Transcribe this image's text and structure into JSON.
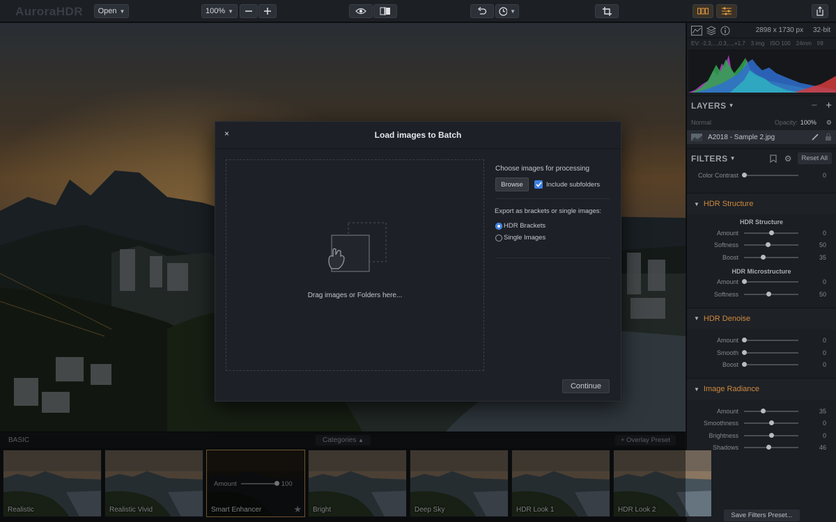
{
  "toolbar": {
    "logo": "AuroraHDR",
    "open_label": "Open",
    "zoom_value": "100%"
  },
  "panel": {
    "image_size": "2898 x 1730 px",
    "bit_depth": "32-bit",
    "exif": [
      "EV: -2.3,...,0.3,...,+1.7",
      "3 img",
      "ISO 100",
      "24mm",
      "f/8"
    ],
    "layers_title": "LAYERS",
    "blend_mode": "Normal",
    "opacity_label": "Opacity:",
    "opacity_value": "100%",
    "layer_name": "A2018 - Sample 2.jpg",
    "filters_title": "FILTERS",
    "reset_label": "Reset All",
    "color_contrast": {
      "label": "Color Contrast",
      "value": "0",
      "level": 0
    },
    "groups": [
      {
        "title": "HDR Structure",
        "subsections": [
          {
            "title": "HDR Structure",
            "rows": [
              {
                "label": "Amount",
                "value": "0",
                "level": 0.5
              },
              {
                "label": "Softness",
                "value": "50",
                "level": 0.44
              },
              {
                "label": "Boost",
                "value": "35",
                "level": 0.35
              }
            ]
          },
          {
            "title": "HDR Microstructure",
            "rows": [
              {
                "label": "Amount",
                "value": "0",
                "level": 0
              },
              {
                "label": "Softness",
                "value": "50",
                "level": 0.46
              }
            ]
          }
        ]
      },
      {
        "title": "HDR Denoise",
        "subsections": [
          {
            "title": "",
            "rows": [
              {
                "label": "Amount",
                "value": "0",
                "level": 0
              },
              {
                "label": "Smooth",
                "value": "0",
                "level": 0
              },
              {
                "label": "Boost",
                "value": "0",
                "level": 0
              }
            ]
          }
        ]
      },
      {
        "title": "Image Radiance",
        "subsections": [
          {
            "title": "",
            "rows": [
              {
                "label": "Amount",
                "value": "35",
                "level": 0.35
              },
              {
                "label": "Smoothness",
                "value": "0",
                "level": 0.5
              },
              {
                "label": "Brightness",
                "value": "0",
                "level": 0.5
              },
              {
                "label": "Shadows",
                "value": "46",
                "level": 0.46
              }
            ]
          }
        ]
      }
    ],
    "save_preset": "Save Filters Preset..."
  },
  "presets": {
    "category": "BASIC",
    "categories_label": "Categories",
    "overlay_label": "+ Overlay Preset",
    "amount_label": "Amount",
    "amount_value": "100",
    "amount_level": 1,
    "items": [
      "Realistic",
      "Realistic Vivid",
      "Smart Enhancer",
      "Bright",
      "Deep Sky",
      "HDR Look 1",
      "HDR Look 2"
    ],
    "selected_index": 2
  },
  "dialog": {
    "title": "Load images to Batch",
    "close": "×",
    "drop_hint": "Drag images or Folders here...",
    "choose_label": "Choose images for processing",
    "browse_label": "Browse",
    "include_subfolders": "Include subfolders",
    "include_checked": true,
    "export_label": "Export as brackets or single images:",
    "options": [
      "HDR Brackets",
      "Single Images"
    ],
    "selected_option": 0,
    "continue_label": "Continue"
  },
  "colors": {
    "accent": "#d08a3f",
    "checkbox": "#3f7fe0"
  }
}
